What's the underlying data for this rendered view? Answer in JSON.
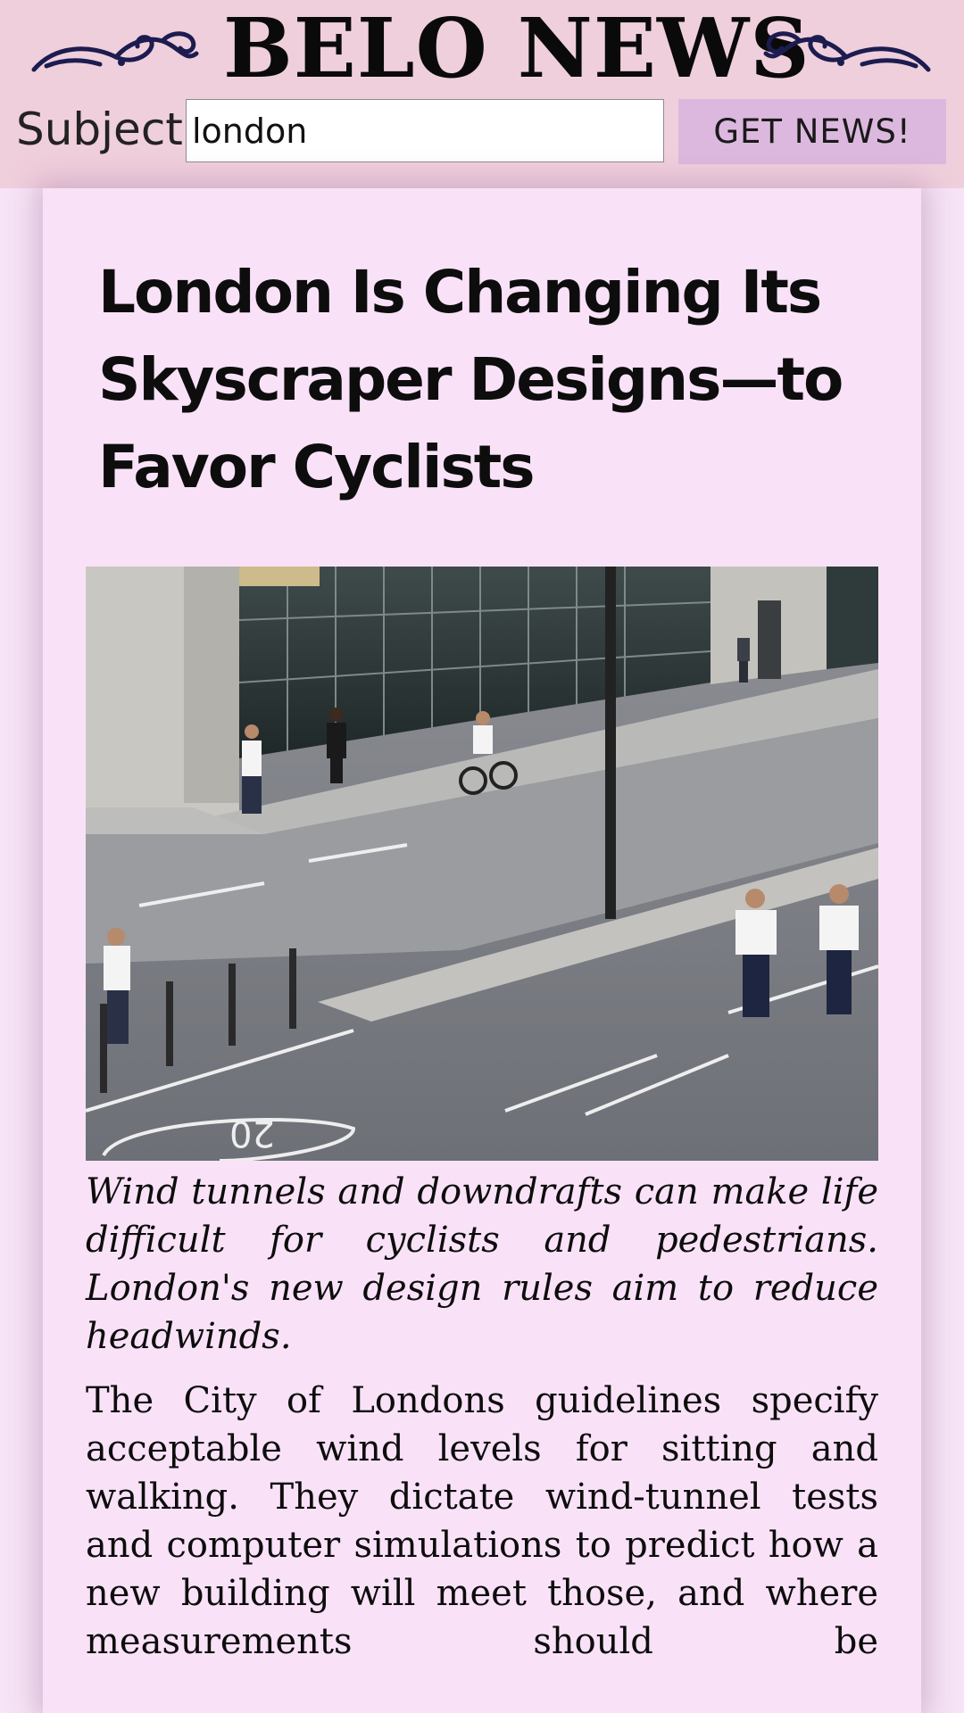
{
  "header": {
    "brand": "BELO NEWS",
    "search_label": "Subject:",
    "search_value": "london",
    "submit_label": "GET NEWS!"
  },
  "article": {
    "headline": "London Is Changing Its Skyscraper Designs—to Favor Cyclists",
    "image_road_marking": "20",
    "caption": "Wind tunnels and downdrafts can make life difficult for cyclists and pedestrians. London's new design rules aim to reduce headwinds.",
    "body": "The City of Londons guidelines specify acceptable wind levels for sitting and walking. They dictate wind-tunnel tests and computer simulations to predict how a new building will meet those, and where measurements should be"
  },
  "colors": {
    "header_bg": "#f0cfdc",
    "button_bg": "#dcb8de",
    "card_bg": "#f9e2f7",
    "page_bg": "#f7e4f6",
    "flourish": "#1c1c50"
  }
}
